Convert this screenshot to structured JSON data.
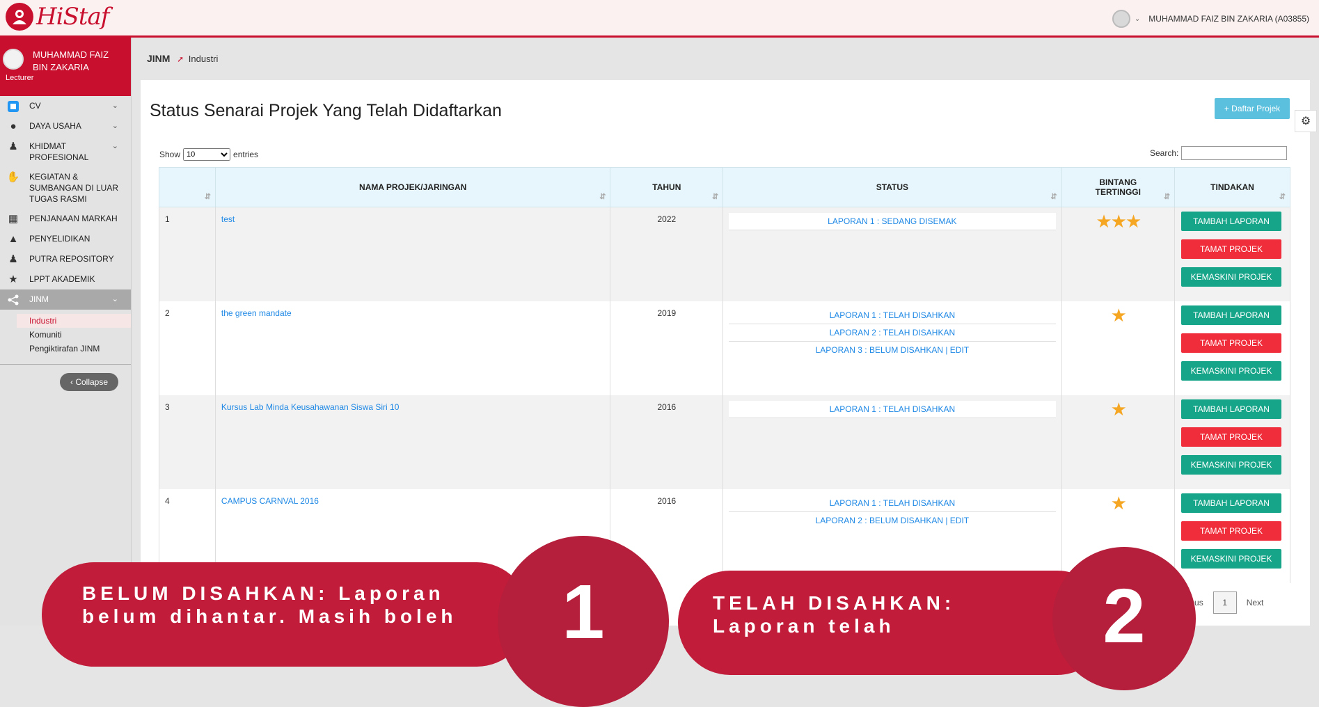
{
  "app": {
    "logo_text": "HiStaf"
  },
  "topbar": {
    "user_label": "MUHAMMAD FAIZ BIN ZAKARIA (A03855)"
  },
  "profile": {
    "name": "MUHAMMAD FAIZ BIN ZAKARIA",
    "role": "Lecturer"
  },
  "sidebar": {
    "items": [
      {
        "label": "CV",
        "icon": "cv-icon"
      },
      {
        "label": "DAYA USAHA",
        "icon": "lightbulb-icon"
      },
      {
        "label": "KHIDMAT PROFESIONAL",
        "icon": "users-icon"
      },
      {
        "label": "KEGIATAN & SUMBANGAN DI LUAR TUGAS RASMI",
        "icon": "hand-icon"
      },
      {
        "label": "PENJANAAN MARKAH",
        "icon": "calculator-icon"
      },
      {
        "label": "PENYELIDIKAN",
        "icon": "flask-icon"
      },
      {
        "label": "PUTRA REPOSITORY",
        "icon": "users-icon"
      },
      {
        "label": "LPPT AKADEMIK",
        "icon": "star-icon"
      },
      {
        "label": "JINM",
        "icon": "share-icon"
      }
    ],
    "subitems": [
      "Industri",
      "Komuniti",
      "Pengiktirafan JINM"
    ],
    "collapse_label": "Collapse"
  },
  "breadcrumb": {
    "root": "JINM",
    "current": "Industri"
  },
  "page": {
    "title": "Status Senarai Projek Yang Telah Didaftarkan",
    "add_button": "+ Daftar Projek",
    "show_label": "Show",
    "show_value": "10",
    "entries_label": "entries",
    "search_label": "Search:"
  },
  "table": {
    "headers": [
      "NAMA PROJEK/JARINGAN",
      "TAHUN",
      "STATUS",
      "BINTANG TERTINGGI",
      "TINDAKAN"
    ],
    "rows": [
      {
        "no": "1",
        "name": "test",
        "year": "2022",
        "status": [
          "LAPORAN 1 : SEDANG DISEMAK"
        ],
        "stars": "★★★"
      },
      {
        "no": "2",
        "name": "the green mandate",
        "year": "2019",
        "status": [
          "LAPORAN 1 : TELAH DISAHKAN",
          "LAPORAN 2 : TELAH DISAHKAN",
          "LAPORAN 3 : BELUM DISAHKAN | EDIT"
        ],
        "stars": "★"
      },
      {
        "no": "3",
        "name": "Kursus Lab Minda Keusahawanan Siswa Siri 10",
        "year": "2016",
        "status": [
          "LAPORAN 1 : TELAH DISAHKAN"
        ],
        "stars": "★"
      },
      {
        "no": "4",
        "name": "CAMPUS CARNVAL 2016",
        "year": "2016",
        "status": [
          "LAPORAN 1 : TELAH DISAHKAN",
          "LAPORAN 2 : BELUM DISAHKAN | EDIT"
        ],
        "stars": "★"
      }
    ],
    "actions": {
      "add_report": "TAMBAH LAPORAN",
      "end_project": "TAMAT PROJEK",
      "update_project": "KEMASKINI PROJEK"
    }
  },
  "pager": {
    "prev": "Previous",
    "page": "1",
    "next": "Next"
  },
  "overlays": {
    "first_text": "BELUM DISAHKAN: Laporan belum dihantar. Masih boleh",
    "first_num": "1",
    "second_text": "TELAH DISAHKAN: Laporan telah",
    "second_num": "2"
  }
}
